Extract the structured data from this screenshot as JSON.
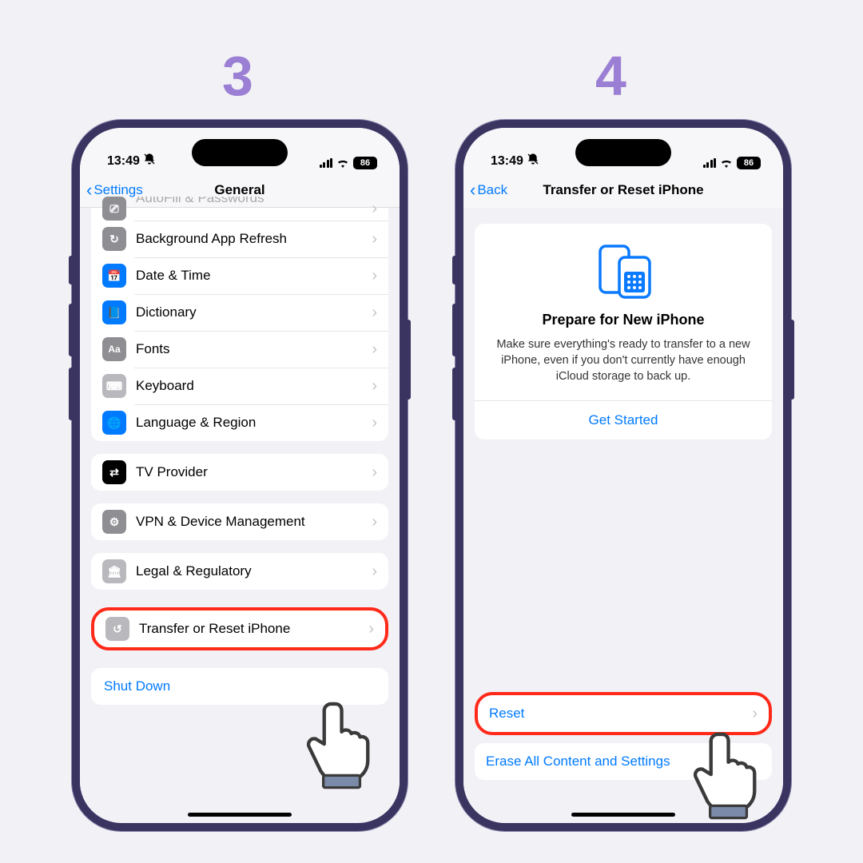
{
  "steps": {
    "left": "3",
    "right": "4"
  },
  "status": {
    "time": "13:49",
    "battery": "86"
  },
  "phone3": {
    "back": "Settings",
    "title": "General",
    "truncated": "AutoFill & Passwords",
    "rows": [
      {
        "label": "Background App Refresh"
      },
      {
        "label": "Date & Time"
      },
      {
        "label": "Dictionary"
      },
      {
        "label": "Fonts"
      },
      {
        "label": "Keyboard"
      },
      {
        "label": "Language & Region"
      }
    ],
    "tv": "TV Provider",
    "vpn": "VPN & Device Management",
    "legal": "Legal & Regulatory",
    "transfer": "Transfer or Reset iPhone",
    "shutdown": "Shut Down"
  },
  "phone4": {
    "back": "Back",
    "title": "Transfer or Reset iPhone",
    "prepTitle": "Prepare for New iPhone",
    "prepDesc": "Make sure everything's ready to transfer to a new iPhone, even if you don't currently have enough iCloud storage to back up.",
    "getStarted": "Get Started",
    "reset": "Reset",
    "erase": "Erase All Content and Settings"
  }
}
